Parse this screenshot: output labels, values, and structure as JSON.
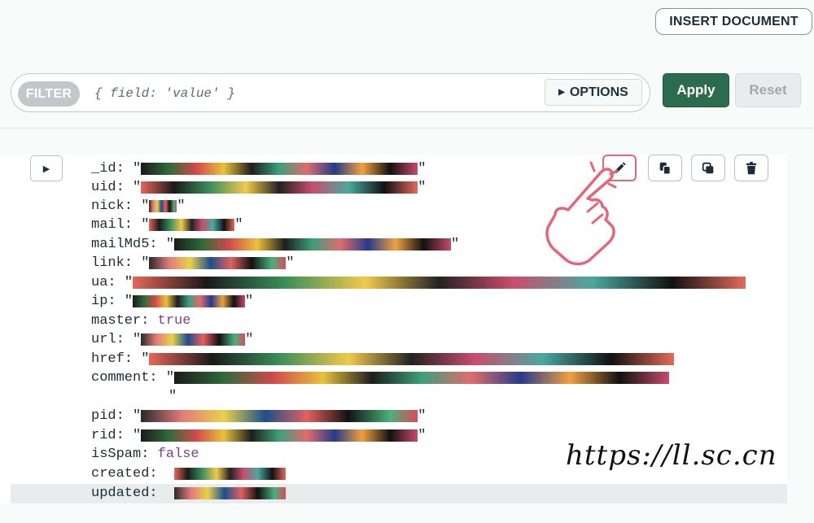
{
  "toolbar": {
    "insert_label": "INSERT DOCUMENT"
  },
  "filter": {
    "pill_label": "FILTER",
    "placeholder": "{ field: 'value' }",
    "options_label": "OPTIONS",
    "apply_label": "Apply",
    "reset_label": "Reset"
  },
  "document": {
    "fields": [
      {
        "key": "_id:",
        "type": "string"
      },
      {
        "key": "uid:",
        "type": "string"
      },
      {
        "key": "nick:",
        "type": "string"
      },
      {
        "key": "mail:",
        "type": "string"
      },
      {
        "key": "mailMd5:",
        "type": "string"
      },
      {
        "key": "link:",
        "type": "string"
      },
      {
        "key": "ua:",
        "type": "string"
      },
      {
        "key": "ip:",
        "type": "string"
      },
      {
        "key": "master:",
        "type": "bool",
        "value": "true"
      },
      {
        "key": "url:",
        "type": "string"
      },
      {
        "key": "href:",
        "type": "string"
      },
      {
        "key": "comment:",
        "type": "string"
      },
      {
        "key": "pid:",
        "type": "string"
      },
      {
        "key": "rid:",
        "type": "string"
      },
      {
        "key": "isSpam:",
        "type": "bool",
        "value": "false"
      },
      {
        "key": "created:",
        "type": "date"
      },
      {
        "key": "updated:",
        "type": "date"
      }
    ]
  },
  "icons": [
    "expand-icon",
    "edit-icon",
    "clone-icon",
    "copy-icon",
    "delete-icon"
  ],
  "colors": {
    "apply": "#2c6b4d",
    "edit_highlight": "#e3677a",
    "keyword": "#7b3f97"
  },
  "watermark": "https://ll.sc.cn"
}
